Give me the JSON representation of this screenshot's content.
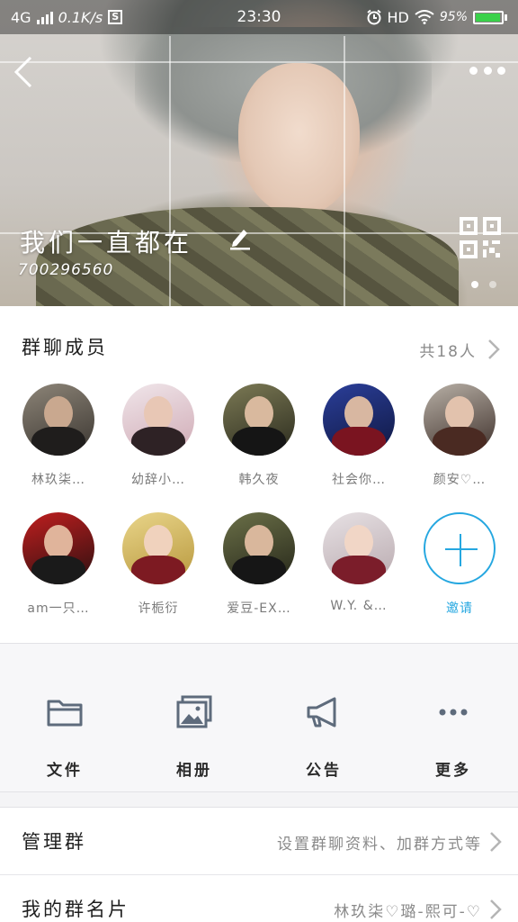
{
  "status_bar": {
    "network": "4G",
    "speed": "0.1K/s",
    "s_badge": "S",
    "time": "23:30",
    "hd": "HD",
    "battery": "95%",
    "battery_level": 0.95
  },
  "header": {
    "group_name": "我们一直都在",
    "group_id": "700296560",
    "carousel_pages": 2,
    "active_page": 0
  },
  "members": {
    "title": "群聊成员",
    "count": "共18人",
    "list": [
      {
        "name": "林玖柒…"
      },
      {
        "name": "幼辞小…"
      },
      {
        "name": "韩久夜"
      },
      {
        "name": "社会你…"
      },
      {
        "name": "颜安♡…"
      },
      {
        "name": "am一只…"
      },
      {
        "name": "许栀衍"
      },
      {
        "name": "爱豆-EX…"
      },
      {
        "name": "W.Y. &…"
      }
    ],
    "invite_label": "邀请"
  },
  "tools": [
    {
      "label": "文件",
      "icon": "folder-icon"
    },
    {
      "label": "相册",
      "icon": "album-icon"
    },
    {
      "label": "公告",
      "icon": "megaphone-icon"
    },
    {
      "label": "更多",
      "icon": "more-dots-icon"
    }
  ],
  "settings": [
    {
      "title": "管理群",
      "value": "设置群聊资料、加群方式等"
    },
    {
      "title": "我的群名片",
      "value": "林玖柒♡璐-熙可-♡"
    }
  ],
  "colors": {
    "accent": "#25a7e0",
    "battery_fill": "#3ad14a"
  }
}
